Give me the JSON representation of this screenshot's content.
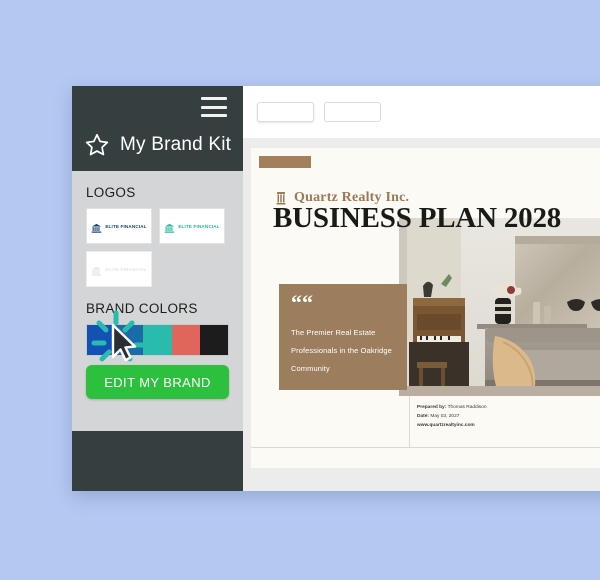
{
  "page": {
    "background_color": "#b4c9f2"
  },
  "sidebar": {
    "menu_icon": "hamburger-menu-icon",
    "star_icon": "star-icon",
    "title": "My Brand Kit",
    "logos_section_label": "LOGOS",
    "logos": [
      {
        "name": "ELITE FINANCIAL",
        "icon": "bank-building-icon",
        "color": "#1c3f74",
        "variant": "navy"
      },
      {
        "name": "ELITE FINANCIAL",
        "icon": "bank-building-icon",
        "color": "#1fb89a",
        "variant": "teal"
      },
      {
        "name": "ELITE FINANCIAL",
        "icon": "bank-building-icon",
        "color": "#e8e8e8",
        "variant": "light"
      }
    ],
    "colors_section_label": "BRAND COLORS",
    "brand_colors": [
      "#1351b4",
      "#1a6ba8",
      "#29bcae",
      "#e0655b",
      "#1c1c1c"
    ],
    "edit_button_label": "EDIT MY BRAND",
    "edit_button_color": "#2cc03e",
    "header_color": "#353f40",
    "body_color": "#d4d5d6",
    "cursor_icon": "mouse-cursor-click-icon"
  },
  "toolbar": {
    "chips": [
      "",
      ""
    ]
  },
  "document": {
    "accent_color": "#a37f5b",
    "company_icon": "building-icon",
    "company_name": "Quartz Realty Inc.",
    "heading": "BUSINESS PLAN 2028",
    "quote": {
      "mark": "““",
      "text": "The Premier Real Estate Professionals in the Oakridge Community",
      "background": "#9c7d5d"
    },
    "photo_alt": "modern living room interior with sofa and piano",
    "meta": {
      "prepared_by_label": "Prepared by:",
      "prepared_by_value": "Thomas Raddison",
      "date_label": "Date:",
      "date_value": "May 03, 2027",
      "website": "www.quartzrealtyinc.com"
    },
    "page_background": "#fbfaf5"
  }
}
